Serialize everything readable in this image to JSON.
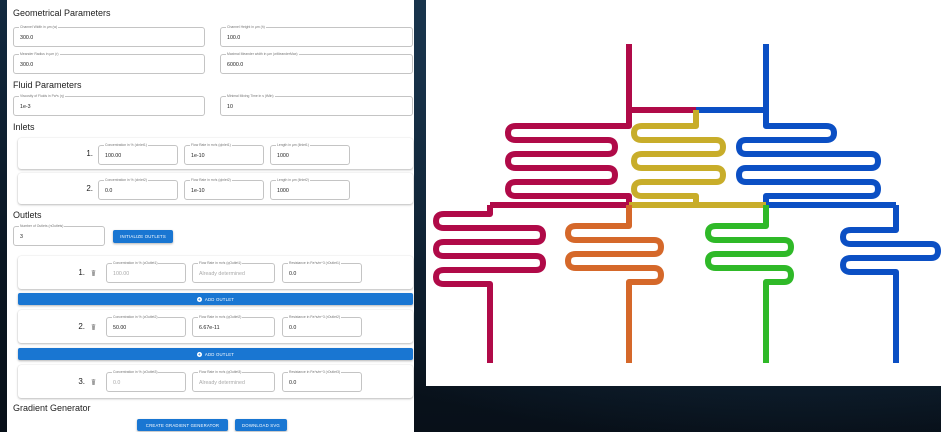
{
  "geometrical": {
    "title": "Geometrical Parameters",
    "channel_width_label": "Channel Width in µm (w)",
    "channel_width": "300.0",
    "channel_height_label": "Channel Height in µm (h)",
    "channel_height": "100.0",
    "meander_radius_label": "Meander Radius in µm (r)",
    "meander_radius": "300.0",
    "max_meander_label": "Maximal Meander width in µm (wMeanderMax)",
    "max_meander": "6000.0"
  },
  "fluid": {
    "title": "Fluid Parameters",
    "viscosity_label": "Viscosity of Fluids in Pa*s (η)",
    "viscosity": "1e-3",
    "mixing_time_label": "Minimal Mixing Time in s (tMin)",
    "mixing_time": "10"
  },
  "inlets": {
    "title": "Inlets",
    "items": [
      {
        "num": "1.",
        "conc_label": "Concentration in % (cInlet1)",
        "conc": "100.00",
        "flow_label": "Flow Rate in m³/s (qInlet1)",
        "flow": "1e-10",
        "len_label": "Length in µm (lInlet1)",
        "len": "1000"
      },
      {
        "num": "2.",
        "conc_label": "Concentration in % (cInlet2)",
        "conc": "0.0",
        "flow_label": "Flow Rate in m³/s (qInlet2)",
        "flow": "1e-10",
        "len_label": "Length in µm (lInlet2)",
        "len": "1000"
      }
    ]
  },
  "outlets": {
    "title": "Outlets",
    "count_label": "Number of Outlets (nOutlets)",
    "count": "3",
    "init_button": "INITIALIZE OUTLETS",
    "add_button": "ADD OUTLET",
    "items": [
      {
        "num": "1.",
        "conc_label": "Concentration in % (cOutlet1)",
        "conc": "100.00",
        "flow_label": "Flow Rate in m³/s (qOutlet1)",
        "flow": "Already determined",
        "res_label": "Resistance in Pa*s/m^3 (rOutlet1)",
        "res": "0.0"
      },
      {
        "num": "2.",
        "conc_label": "Concentration in % (cOutlet2)",
        "conc": "50.00",
        "flow_label": "Flow Rate in m³/s (qOutlet2)",
        "flow": "6.67e-11",
        "res_label": "Resistance in Pa*s/m^3 (rOutlet2)",
        "res": "0.0"
      },
      {
        "num": "3.",
        "conc_label": "Concentration in % (cOutlet3)",
        "conc": "0.0",
        "flow_label": "Flow Rate in m³/s (qOutlet3)",
        "flow": "Already determined",
        "res_label": "Resistance in Pa*s/m^3 (rOutlet3)",
        "res": "0.0"
      }
    ]
  },
  "gradient": {
    "title": "Gradient Generator",
    "create_button": "CREATE GRADIENT GENERATOR",
    "download_button": "DOWNLOAD SVG"
  },
  "colors": {
    "accent": "#1976d2",
    "crimson": "#b00a48",
    "orange": "#d5682a",
    "yellow": "#c8ad2a",
    "green": "#2fb928",
    "blue": "#0b4fc4"
  },
  "icons": {
    "delete": "trash-icon",
    "add": "add-circle-icon"
  }
}
